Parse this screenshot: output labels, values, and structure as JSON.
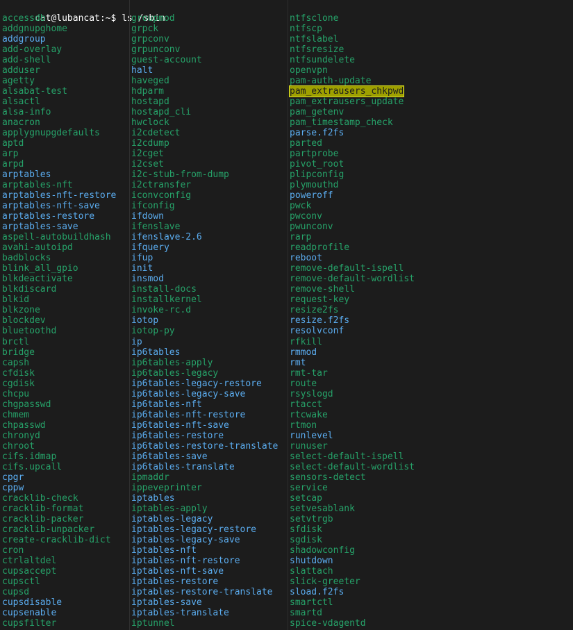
{
  "terminal": {
    "title": "cat@lubancat: ~",
    "background": "#1c1c1c",
    "exec_color": "#26a269",
    "symlink_color": "#5badf0",
    "highlight_bg": "#9ea000",
    "highlight_fg": "#1c1c1c",
    "highlight_border": "#d8db26",
    "prompt": {
      "user_host": "cat@lubancat",
      "path": ":~$",
      "full": "cat@lubancat:~$ ls /sbin",
      "command": "ls /sbin"
    },
    "search_match": "pam_extrausers_chkpwd",
    "columns": 3,
    "listing": [
      [
        {
          "name": "accessdb",
          "type": "exe"
        },
        {
          "name": "groupmod",
          "type": "exe"
        },
        {
          "name": "ntfsclone",
          "type": "exe"
        }
      ],
      [
        {
          "name": "addgnupghome",
          "type": "exe"
        },
        {
          "name": "grpck",
          "type": "exe"
        },
        {
          "name": "ntfscp",
          "type": "exe"
        }
      ],
      [
        {
          "name": "addgroup",
          "type": "lnk"
        },
        {
          "name": "grpconv",
          "type": "exe"
        },
        {
          "name": "ntfslabel",
          "type": "exe"
        }
      ],
      [
        {
          "name": "add-overlay",
          "type": "exe"
        },
        {
          "name": "grpunconv",
          "type": "exe"
        },
        {
          "name": "ntfsresize",
          "type": "exe"
        }
      ],
      [
        {
          "name": "add-shell",
          "type": "exe"
        },
        {
          "name": "guest-account",
          "type": "exe"
        },
        {
          "name": "ntfsundelete",
          "type": "exe"
        }
      ],
      [
        {
          "name": "adduser",
          "type": "exe"
        },
        {
          "name": "halt",
          "type": "lnk"
        },
        {
          "name": "openvpn",
          "type": "exe"
        }
      ],
      [
        {
          "name": "agetty",
          "type": "exe"
        },
        {
          "name": "haveged",
          "type": "exe"
        },
        {
          "name": "pam-auth-update",
          "type": "exe"
        }
      ],
      [
        {
          "name": "alsabat-test",
          "type": "exe"
        },
        {
          "name": "hdparm",
          "type": "exe"
        },
        {
          "name": "pam_extrausers_chkpwd",
          "type": "hl"
        }
      ],
      [
        {
          "name": "alsactl",
          "type": "exe"
        },
        {
          "name": "hostapd",
          "type": "exe"
        },
        {
          "name": "pam_extrausers_update",
          "type": "exe"
        }
      ],
      [
        {
          "name": "alsa-info",
          "type": "exe"
        },
        {
          "name": "hostapd_cli",
          "type": "exe"
        },
        {
          "name": "pam_getenv",
          "type": "exe"
        }
      ],
      [
        {
          "name": "anacron",
          "type": "exe"
        },
        {
          "name": "hwclock",
          "type": "exe"
        },
        {
          "name": "pam_timestamp_check",
          "type": "exe"
        }
      ],
      [
        {
          "name": "applygnupgdefaults",
          "type": "exe"
        },
        {
          "name": "i2cdetect",
          "type": "exe"
        },
        {
          "name": "parse.f2fs",
          "type": "lnk"
        }
      ],
      [
        {
          "name": "aptd",
          "type": "exe"
        },
        {
          "name": "i2cdump",
          "type": "exe"
        },
        {
          "name": "parted",
          "type": "exe"
        }
      ],
      [
        {
          "name": "arp",
          "type": "exe"
        },
        {
          "name": "i2cget",
          "type": "exe"
        },
        {
          "name": "partprobe",
          "type": "exe"
        }
      ],
      [
        {
          "name": "arpd",
          "type": "exe"
        },
        {
          "name": "i2cset",
          "type": "exe"
        },
        {
          "name": "pivot_root",
          "type": "exe"
        }
      ],
      [
        {
          "name": "arptables",
          "type": "lnk"
        },
        {
          "name": "i2c-stub-from-dump",
          "type": "exe"
        },
        {
          "name": "plipconfig",
          "type": "exe"
        }
      ],
      [
        {
          "name": "arptables-nft",
          "type": "exe"
        },
        {
          "name": "i2ctransfer",
          "type": "exe"
        },
        {
          "name": "plymouthd",
          "type": "exe"
        }
      ],
      [
        {
          "name": "arptables-nft-restore",
          "type": "lnk"
        },
        {
          "name": "iconvconfig",
          "type": "exe"
        },
        {
          "name": "poweroff",
          "type": "lnk"
        }
      ],
      [
        {
          "name": "arptables-nft-save",
          "type": "lnk"
        },
        {
          "name": "ifconfig",
          "type": "exe"
        },
        {
          "name": "pwck",
          "type": "exe"
        }
      ],
      [
        {
          "name": "arptables-restore",
          "type": "lnk"
        },
        {
          "name": "ifdown",
          "type": "lnk"
        },
        {
          "name": "pwconv",
          "type": "exe"
        }
      ],
      [
        {
          "name": "arptables-save",
          "type": "lnk"
        },
        {
          "name": "ifenslave",
          "type": "exe"
        },
        {
          "name": "pwunconv",
          "type": "exe"
        }
      ],
      [
        {
          "name": "aspell-autobuildhash",
          "type": "exe"
        },
        {
          "name": "ifenslave-2.6",
          "type": "lnk"
        },
        {
          "name": "rarp",
          "type": "exe"
        }
      ],
      [
        {
          "name": "avahi-autoipd",
          "type": "exe"
        },
        {
          "name": "ifquery",
          "type": "lnk"
        },
        {
          "name": "readprofile",
          "type": "exe"
        }
      ],
      [
        {
          "name": "badblocks",
          "type": "exe"
        },
        {
          "name": "ifup",
          "type": "lnk"
        },
        {
          "name": "reboot",
          "type": "lnk"
        }
      ],
      [
        {
          "name": "blink_all_gpio",
          "type": "exe"
        },
        {
          "name": "init",
          "type": "lnk"
        },
        {
          "name": "remove-default-ispell",
          "type": "exe"
        }
      ],
      [
        {
          "name": "blkdeactivate",
          "type": "exe"
        },
        {
          "name": "insmod",
          "type": "lnk"
        },
        {
          "name": "remove-default-wordlist",
          "type": "exe"
        }
      ],
      [
        {
          "name": "blkdiscard",
          "type": "exe"
        },
        {
          "name": "install-docs",
          "type": "exe"
        },
        {
          "name": "remove-shell",
          "type": "exe"
        }
      ],
      [
        {
          "name": "blkid",
          "type": "exe"
        },
        {
          "name": "installkernel",
          "type": "exe"
        },
        {
          "name": "request-key",
          "type": "exe"
        }
      ],
      [
        {
          "name": "blkzone",
          "type": "exe"
        },
        {
          "name": "invoke-rc.d",
          "type": "exe"
        },
        {
          "name": "resize2fs",
          "type": "exe"
        }
      ],
      [
        {
          "name": "blockdev",
          "type": "exe"
        },
        {
          "name": "iotop",
          "type": "lnk"
        },
        {
          "name": "resize.f2fs",
          "type": "lnk"
        }
      ],
      [
        {
          "name": "bluetoothd",
          "type": "exe"
        },
        {
          "name": "iotop-py",
          "type": "exe"
        },
        {
          "name": "resolvconf",
          "type": "lnk"
        }
      ],
      [
        {
          "name": "brctl",
          "type": "exe"
        },
        {
          "name": "ip",
          "type": "lnk"
        },
        {
          "name": "rfkill",
          "type": "exe"
        }
      ],
      [
        {
          "name": "bridge",
          "type": "exe"
        },
        {
          "name": "ip6tables",
          "type": "lnk"
        },
        {
          "name": "rmmod",
          "type": "lnk"
        }
      ],
      [
        {
          "name": "capsh",
          "type": "exe"
        },
        {
          "name": "ip6tables-apply",
          "type": "exe"
        },
        {
          "name": "rmt",
          "type": "lnk"
        }
      ],
      [
        {
          "name": "cfdisk",
          "type": "exe"
        },
        {
          "name": "ip6tables-legacy",
          "type": "exe"
        },
        {
          "name": "rmt-tar",
          "type": "exe"
        }
      ],
      [
        {
          "name": "cgdisk",
          "type": "exe"
        },
        {
          "name": "ip6tables-legacy-restore",
          "type": "lnk"
        },
        {
          "name": "route",
          "type": "exe"
        }
      ],
      [
        {
          "name": "chcpu",
          "type": "exe"
        },
        {
          "name": "ip6tables-legacy-save",
          "type": "lnk"
        },
        {
          "name": "rsyslogd",
          "type": "exe"
        }
      ],
      [
        {
          "name": "chgpasswd",
          "type": "exe"
        },
        {
          "name": "ip6tables-nft",
          "type": "lnk"
        },
        {
          "name": "rtacct",
          "type": "exe"
        }
      ],
      [
        {
          "name": "chmem",
          "type": "exe"
        },
        {
          "name": "ip6tables-nft-restore",
          "type": "lnk"
        },
        {
          "name": "rtcwake",
          "type": "exe"
        }
      ],
      [
        {
          "name": "chpasswd",
          "type": "exe"
        },
        {
          "name": "ip6tables-nft-save",
          "type": "lnk"
        },
        {
          "name": "rtmon",
          "type": "exe"
        }
      ],
      [
        {
          "name": "chronyd",
          "type": "exe"
        },
        {
          "name": "ip6tables-restore",
          "type": "lnk"
        },
        {
          "name": "runlevel",
          "type": "lnk"
        }
      ],
      [
        {
          "name": "chroot",
          "type": "exe"
        },
        {
          "name": "ip6tables-restore-translate",
          "type": "lnk"
        },
        {
          "name": "runuser",
          "type": "exe"
        }
      ],
      [
        {
          "name": "cifs.idmap",
          "type": "exe"
        },
        {
          "name": "ip6tables-save",
          "type": "lnk"
        },
        {
          "name": "select-default-ispell",
          "type": "exe"
        }
      ],
      [
        {
          "name": "cifs.upcall",
          "type": "exe"
        },
        {
          "name": "ip6tables-translate",
          "type": "lnk"
        },
        {
          "name": "select-default-wordlist",
          "type": "exe"
        }
      ],
      [
        {
          "name": "cpgr",
          "type": "lnk"
        },
        {
          "name": "ipmaddr",
          "type": "exe"
        },
        {
          "name": "sensors-detect",
          "type": "exe"
        }
      ],
      [
        {
          "name": "cppw",
          "type": "lnk"
        },
        {
          "name": "ippeveprinter",
          "type": "exe"
        },
        {
          "name": "service",
          "type": "exe"
        }
      ],
      [
        {
          "name": "cracklib-check",
          "type": "exe"
        },
        {
          "name": "iptables",
          "type": "lnk"
        },
        {
          "name": "setcap",
          "type": "exe"
        }
      ],
      [
        {
          "name": "cracklib-format",
          "type": "exe"
        },
        {
          "name": "iptables-apply",
          "type": "exe"
        },
        {
          "name": "setvesablank",
          "type": "exe"
        }
      ],
      [
        {
          "name": "cracklib-packer",
          "type": "exe"
        },
        {
          "name": "iptables-legacy",
          "type": "lnk"
        },
        {
          "name": "setvtrgb",
          "type": "exe"
        }
      ],
      [
        {
          "name": "cracklib-unpacker",
          "type": "exe"
        },
        {
          "name": "iptables-legacy-restore",
          "type": "lnk"
        },
        {
          "name": "sfdisk",
          "type": "exe"
        }
      ],
      [
        {
          "name": "create-cracklib-dict",
          "type": "exe"
        },
        {
          "name": "iptables-legacy-save",
          "type": "lnk"
        },
        {
          "name": "sgdisk",
          "type": "exe"
        }
      ],
      [
        {
          "name": "cron",
          "type": "exe"
        },
        {
          "name": "iptables-nft",
          "type": "lnk"
        },
        {
          "name": "shadowconfig",
          "type": "exe"
        }
      ],
      [
        {
          "name": "ctrlaltdel",
          "type": "exe"
        },
        {
          "name": "iptables-nft-restore",
          "type": "lnk"
        },
        {
          "name": "shutdown",
          "type": "lnk"
        }
      ],
      [
        {
          "name": "cupsaccept",
          "type": "exe"
        },
        {
          "name": "iptables-nft-save",
          "type": "lnk"
        },
        {
          "name": "slattach",
          "type": "exe"
        }
      ],
      [
        {
          "name": "cupsctl",
          "type": "exe"
        },
        {
          "name": "iptables-restore",
          "type": "lnk"
        },
        {
          "name": "slick-greeter",
          "type": "exe"
        }
      ],
      [
        {
          "name": "cupsd",
          "type": "exe"
        },
        {
          "name": "iptables-restore-translate",
          "type": "lnk"
        },
        {
          "name": "sload.f2fs",
          "type": "lnk"
        }
      ],
      [
        {
          "name": "cupsdisable",
          "type": "lnk"
        },
        {
          "name": "iptables-save",
          "type": "lnk"
        },
        {
          "name": "smartctl",
          "type": "exe"
        }
      ],
      [
        {
          "name": "cupsenable",
          "type": "lnk"
        },
        {
          "name": "iptables-translate",
          "type": "lnk"
        },
        {
          "name": "smartd",
          "type": "exe"
        }
      ],
      [
        {
          "name": "cupsfilter",
          "type": "exe"
        },
        {
          "name": "iptunnel",
          "type": "exe"
        },
        {
          "name": "spice-vdagentd",
          "type": "exe"
        }
      ]
    ]
  }
}
